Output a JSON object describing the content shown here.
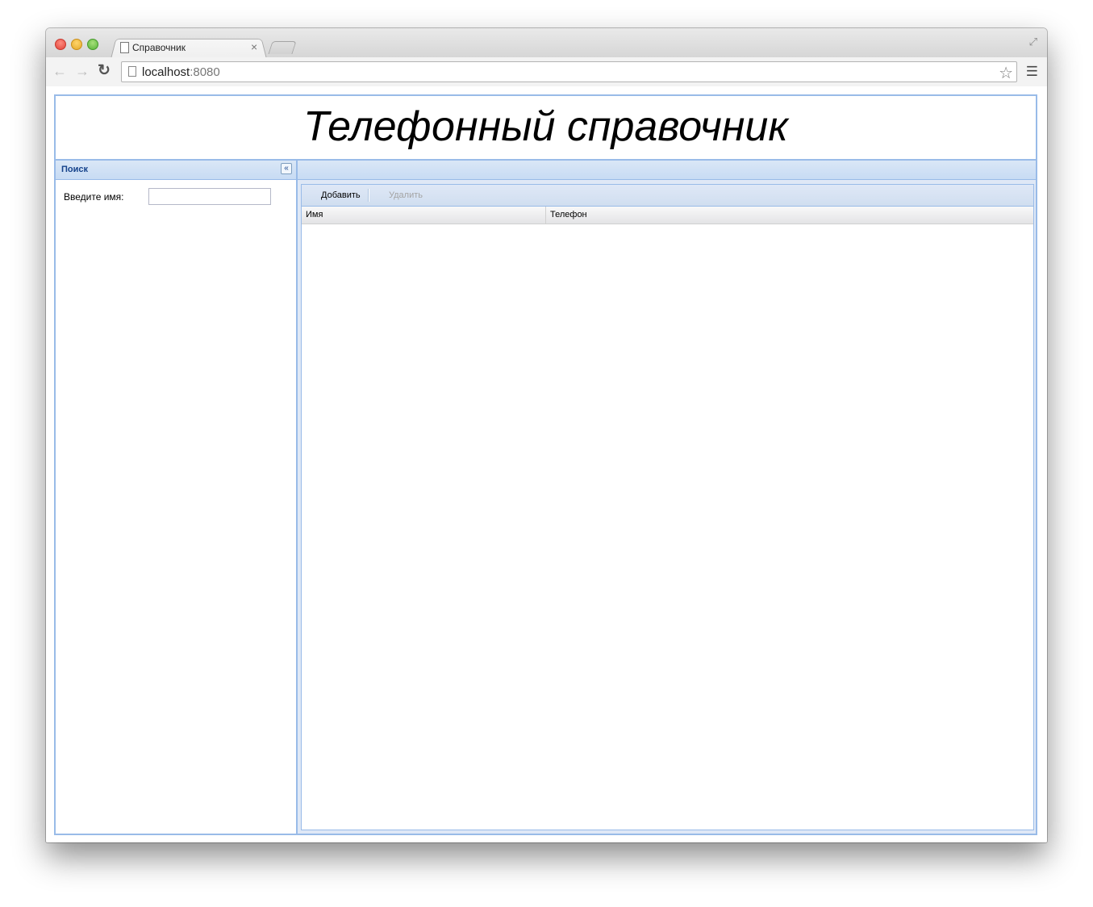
{
  "browser": {
    "tab_title": "Справочник",
    "tab_close": "×",
    "url_host": "localhost",
    "url_port": ":8080",
    "icons": [
      "document-icon",
      "back-icon",
      "forward-icon",
      "reload-icon",
      "star-icon",
      "menu-icon",
      "fullscreen-icon",
      "close-icon"
    ]
  },
  "app": {
    "title": "Телефонный справочник",
    "search_panel": {
      "title": "Поиск",
      "collapse_glyph": "«",
      "name_label": "Введите имя:",
      "name_value": ""
    },
    "grid": {
      "toolbar": {
        "add_label": "Добавить",
        "delete_label": "Удалить"
      },
      "columns": [
        "Имя",
        "Телефон"
      ],
      "rows": []
    }
  },
  "colors": {
    "panel_border": "#99bbe8",
    "panel_title": "#15428b"
  }
}
